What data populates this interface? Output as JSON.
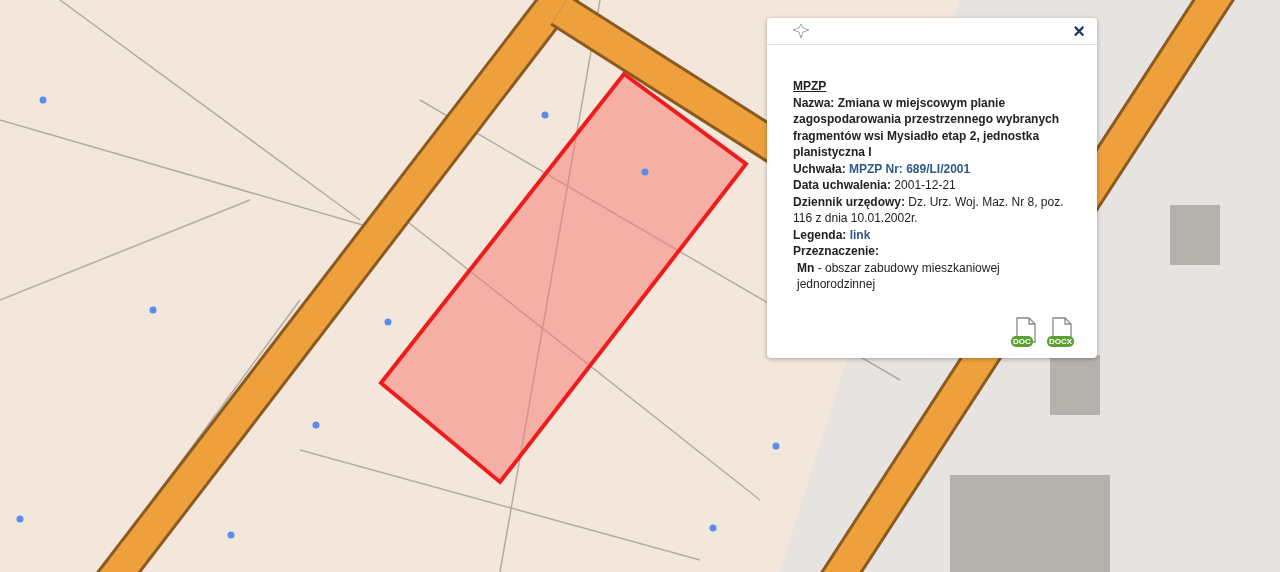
{
  "popup": {
    "close": "×",
    "title": "MPZP",
    "fields": [
      {
        "kind": "bold",
        "label": "Nazwa:",
        "value": "Zmiana w miejscowym planie zagospodarowania przestrzennego wybranych fragmentów wsi Mysiadło etap 2, jednostka planistyczna I"
      },
      {
        "kind": "link",
        "label": "Uchwała:",
        "value": "MPZP Nr: 689/LI/2001"
      },
      {
        "kind": "plain",
        "label": "Data uchwalenia:",
        "value": "2001-12-21"
      },
      {
        "kind": "plain",
        "label": "Dziennik urzędowy:",
        "value": "Dz. Urz. Woj. Maz. Nr 8, poz. 116 z dnia 10.01.2002r."
      },
      {
        "kind": "link",
        "label": "Legenda:",
        "value": "link"
      },
      {
        "kind": "heading",
        "label": "Przeznaczenie:"
      }
    ],
    "purpose": {
      "code": "Mn",
      "text": "- obszar zabudowy mieszkaniowej jednorodzinnej"
    },
    "downloads": [
      "DOC",
      "DOCX"
    ]
  }
}
